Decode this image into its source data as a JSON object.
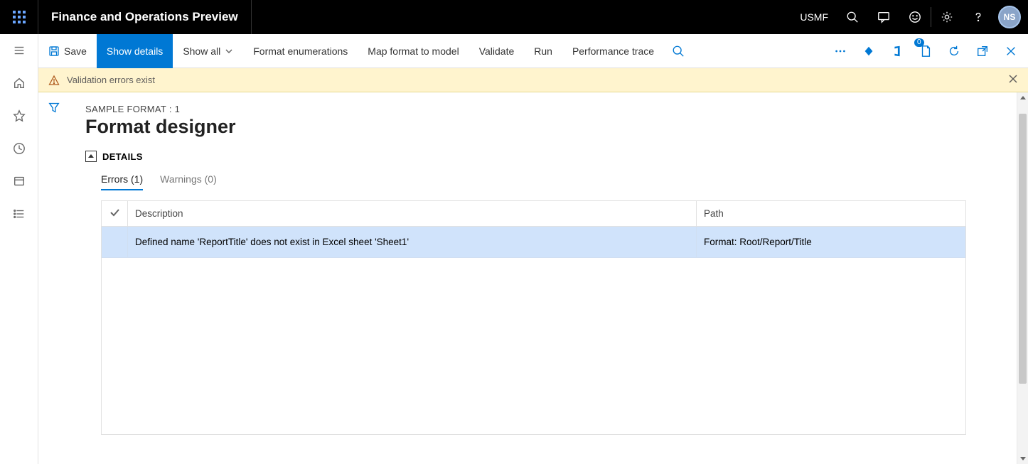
{
  "header": {
    "app_title": "Finance and Operations Preview",
    "entity": "USMF",
    "avatar_initials": "NS"
  },
  "action_bar": {
    "save": "Save",
    "show_details": "Show details",
    "show_all": "Show all",
    "format_enum": "Format enumerations",
    "map_model": "Map format to model",
    "validate": "Validate",
    "run": "Run",
    "perf_trace": "Performance trace",
    "attachments_badge": "0"
  },
  "message_bar": {
    "text": "Validation errors exist"
  },
  "page": {
    "breadcrumb": "SAMPLE FORMAT : 1",
    "title": "Format designer",
    "section": "DETAILS"
  },
  "tabs": {
    "errors": "Errors (1)",
    "warnings": "Warnings (0)"
  },
  "grid": {
    "columns": {
      "description": "Description",
      "path": "Path"
    },
    "rows": [
      {
        "description": "Defined name 'ReportTitle' does not exist in Excel sheet 'Sheet1'",
        "path": "Format: Root/Report/Title"
      }
    ]
  }
}
